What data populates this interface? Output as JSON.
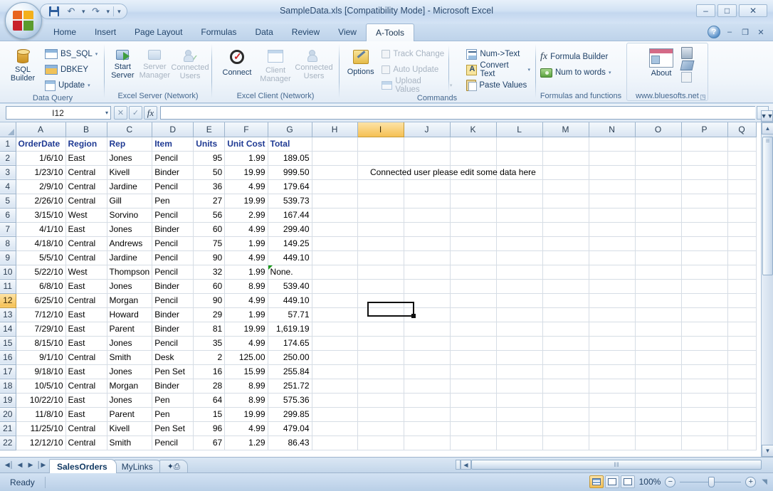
{
  "window": {
    "title": "SampleData.xls [Compatibility Mode] - Microsoft Excel",
    "minimize": "–",
    "maximize": "□",
    "close": "✕"
  },
  "quick_access": {
    "save": "save-icon",
    "undo": "↶",
    "redo": "↷",
    "customize": "▾"
  },
  "ribbon_tabs": [
    {
      "label": "Home",
      "active": false
    },
    {
      "label": "Insert",
      "active": false
    },
    {
      "label": "Page Layout",
      "active": false
    },
    {
      "label": "Formulas",
      "active": false
    },
    {
      "label": "Data",
      "active": false
    },
    {
      "label": "Review",
      "active": false
    },
    {
      "label": "View",
      "active": false
    },
    {
      "label": "A-Tools",
      "active": true
    }
  ],
  "tab_right": {
    "help": "?",
    "ribbon_minimize": "–",
    "restore": "❐",
    "close": "✕"
  },
  "ribbon": {
    "groups": [
      {
        "title": "Data Query",
        "big_buttons": [
          {
            "label": "SQL\nBuilder",
            "label_l1": "SQL",
            "label_l2": "Builder",
            "enabled": true
          }
        ],
        "small_buttons": [
          {
            "label": "BS_SQL",
            "dropdown": true,
            "enabled": true
          },
          {
            "label": "DBKEY",
            "dropdown": false,
            "enabled": true
          },
          {
            "label": "Update",
            "dropdown": true,
            "enabled": true
          }
        ]
      },
      {
        "title": "Excel Server (Network)",
        "big_buttons": [
          {
            "label_l1": "Start",
            "label_l2": "Server",
            "enabled": true
          },
          {
            "label_l1": "Server",
            "label_l2": "Manager",
            "enabled": false
          },
          {
            "label_l1": "Connected",
            "label_l2": "Users",
            "enabled": false
          }
        ],
        "small_buttons": []
      },
      {
        "title": "Excel Client (Network)",
        "big_buttons": [
          {
            "label_l1": "Connect",
            "label_l2": "",
            "enabled": true
          },
          {
            "label_l1": "Client",
            "label_l2": "Manager",
            "enabled": false
          },
          {
            "label_l1": "Connected",
            "label_l2": "Users",
            "enabled": false
          }
        ],
        "small_buttons": []
      },
      {
        "title": "Commands",
        "big_buttons": [
          {
            "label_l1": "Options",
            "label_l2": "",
            "enabled": true
          }
        ],
        "small_buttons": [
          {
            "label": "Track Change",
            "dropdown": false,
            "enabled": false,
            "checkbox": true
          },
          {
            "label": "Auto Update",
            "dropdown": false,
            "enabled": false,
            "checkbox": true
          },
          {
            "label": "Upload Values",
            "dropdown": true,
            "enabled": false
          },
          {
            "label": "Num->Text",
            "dropdown": false,
            "enabled": true
          },
          {
            "label": "Convert Text",
            "dropdown": true,
            "enabled": true
          },
          {
            "label": "Paste Values",
            "dropdown": false,
            "enabled": true
          }
        ]
      },
      {
        "title": "Formulas and functions",
        "big_buttons": [],
        "small_buttons": [
          {
            "label": "Formula Builder",
            "dropdown": false,
            "enabled": true
          },
          {
            "label": "Num to words",
            "dropdown": true,
            "enabled": true
          }
        ]
      },
      {
        "title": "www.bluesofts.net",
        "big_buttons": [
          {
            "label_l1": "About",
            "label_l2": "",
            "enabled": true
          }
        ],
        "small_buttons": [],
        "dialog_launcher": "◳"
      }
    ]
  },
  "formula_bar": {
    "name_box_value": "I12",
    "name_box_arrow": "▾",
    "cancel": "✕",
    "enter": "✓",
    "insert_function": "fx",
    "formula_value": "",
    "expand_arrow": "▾"
  },
  "grid": {
    "column_headers": [
      "A",
      "B",
      "C",
      "D",
      "E",
      "F",
      "G",
      "H",
      "I",
      "J",
      "K",
      "L",
      "M",
      "N",
      "O",
      "P",
      "Q"
    ],
    "selected_column": "I",
    "selected_row": "12",
    "selected_cell": "I12",
    "row_numbers": [
      "1",
      "2",
      "3",
      "4",
      "5",
      "6",
      "7",
      "8",
      "9",
      "10",
      "11",
      "12",
      "13",
      "14",
      "15",
      "16",
      "17",
      "18",
      "19",
      "20",
      "21",
      "22"
    ],
    "headers": [
      "OrderDate",
      "Region",
      "Rep",
      "Item",
      "Units",
      "Unit Cost",
      "Total"
    ],
    "rows": [
      {
        "n": "2",
        "OrderDate": "1/6/10",
        "Region": "East",
        "Rep": "Jones",
        "Item": "Pencil",
        "Units": "95",
        "UnitCost": "1.99",
        "Total": "189.05"
      },
      {
        "n": "3",
        "OrderDate": "1/23/10",
        "Region": "Central",
        "Rep": "Kivell",
        "Item": "Binder",
        "Units": "50",
        "UnitCost": "19.99",
        "Total": "999.50"
      },
      {
        "n": "4",
        "OrderDate": "2/9/10",
        "Region": "Central",
        "Rep": "Jardine",
        "Item": "Pencil",
        "Units": "36",
        "UnitCost": "4.99",
        "Total": "179.64"
      },
      {
        "n": "5",
        "OrderDate": "2/26/10",
        "Region": "Central",
        "Rep": "Gill",
        "Item": "Pen",
        "Units": "27",
        "UnitCost": "19.99",
        "Total": "539.73"
      },
      {
        "n": "6",
        "OrderDate": "3/15/10",
        "Region": "West",
        "Rep": "Sorvino",
        "Item": "Pencil",
        "Units": "56",
        "UnitCost": "2.99",
        "Total": "167.44"
      },
      {
        "n": "7",
        "OrderDate": "4/1/10",
        "Region": "East",
        "Rep": "Jones",
        "Item": "Binder",
        "Units": "60",
        "UnitCost": "4.99",
        "Total": "299.40"
      },
      {
        "n": "8",
        "OrderDate": "4/18/10",
        "Region": "Central",
        "Rep": "Andrews",
        "Item": "Pencil",
        "Units": "75",
        "UnitCost": "1.99",
        "Total": "149.25"
      },
      {
        "n": "9",
        "OrderDate": "5/5/10",
        "Region": "Central",
        "Rep": "Jardine",
        "Item": "Pencil",
        "Units": "90",
        "UnitCost": "4.99",
        "Total": "449.10"
      },
      {
        "n": "10",
        "OrderDate": "5/22/10",
        "Region": "West",
        "Rep": "Thompson",
        "Item": "Pencil",
        "Units": "32",
        "UnitCost": "1.99",
        "Total": "None.",
        "total_error": true,
        "total_left": true
      },
      {
        "n": "11",
        "OrderDate": "6/8/10",
        "Region": "East",
        "Rep": "Jones",
        "Item": "Binder",
        "Units": "60",
        "UnitCost": "8.99",
        "Total": "539.40"
      },
      {
        "n": "12",
        "OrderDate": "6/25/10",
        "Region": "Central",
        "Rep": "Morgan",
        "Item": "Pencil",
        "Units": "90",
        "UnitCost": "4.99",
        "Total": "449.10"
      },
      {
        "n": "13",
        "OrderDate": "7/12/10",
        "Region": "East",
        "Rep": "Howard",
        "Item": "Binder",
        "Units": "29",
        "UnitCost": "1.99",
        "Total": "57.71"
      },
      {
        "n": "14",
        "OrderDate": "7/29/10",
        "Region": "East",
        "Rep": "Parent",
        "Item": "Binder",
        "Units": "81",
        "UnitCost": "19.99",
        "Total": "1,619.19"
      },
      {
        "n": "15",
        "OrderDate": "8/15/10",
        "Region": "East",
        "Rep": "Jones",
        "Item": "Pencil",
        "Units": "35",
        "UnitCost": "4.99",
        "Total": "174.65"
      },
      {
        "n": "16",
        "OrderDate": "9/1/10",
        "Region": "Central",
        "Rep": "Smith",
        "Item": "Desk",
        "Units": "2",
        "UnitCost": "125.00",
        "Total": "250.00"
      },
      {
        "n": "17",
        "OrderDate": "9/18/10",
        "Region": "East",
        "Rep": "Jones",
        "Item": "Pen Set",
        "Units": "16",
        "UnitCost": "15.99",
        "Total": "255.84"
      },
      {
        "n": "18",
        "OrderDate": "10/5/10",
        "Region": "Central",
        "Rep": "Morgan",
        "Item": "Binder",
        "Units": "28",
        "UnitCost": "8.99",
        "Total": "251.72"
      },
      {
        "n": "19",
        "OrderDate": "10/22/10",
        "Region": "East",
        "Rep": "Jones",
        "Item": "Pen",
        "Units": "64",
        "UnitCost": "8.99",
        "Total": "575.36"
      },
      {
        "n": "20",
        "OrderDate": "11/8/10",
        "Region": "East",
        "Rep": "Parent",
        "Item": "Pen",
        "Units": "15",
        "UnitCost": "19.99",
        "Total": "299.85"
      },
      {
        "n": "21",
        "OrderDate": "11/25/10",
        "Region": "Central",
        "Rep": "Kivell",
        "Item": "Pen Set",
        "Units": "96",
        "UnitCost": "4.99",
        "Total": "479.04"
      },
      {
        "n": "22",
        "OrderDate": "12/12/10",
        "Region": "Central",
        "Rep": "Smith",
        "Item": "Pencil",
        "Units": "67",
        "UnitCost": "1.29",
        "Total": "86.43"
      }
    ],
    "note": {
      "text": "Connected user please edit some data here",
      "cell": "I4"
    }
  },
  "sheet_tabs": {
    "nav": {
      "first": "◀│",
      "prev": "◀",
      "next": "▶",
      "last": "│▶"
    },
    "tabs": [
      {
        "label": "SalesOrders",
        "active": true
      },
      {
        "label": "MyLinks",
        "active": false
      }
    ],
    "new_sheet_icon": "new-sheet-icon"
  },
  "status_bar": {
    "text": "Ready",
    "views": [
      {
        "name": "normal-view",
        "active": true
      },
      {
        "name": "page-layout-view",
        "active": false
      },
      {
        "name": "page-break-preview",
        "active": false
      }
    ],
    "zoom_level": "100%",
    "zoom_out": "−",
    "zoom_in": "+"
  },
  "colors": {
    "header_text": "#1f3a93",
    "selection": "#f5c053",
    "accent": "#2b4a6e",
    "error_flag": "#1a9a1a"
  }
}
